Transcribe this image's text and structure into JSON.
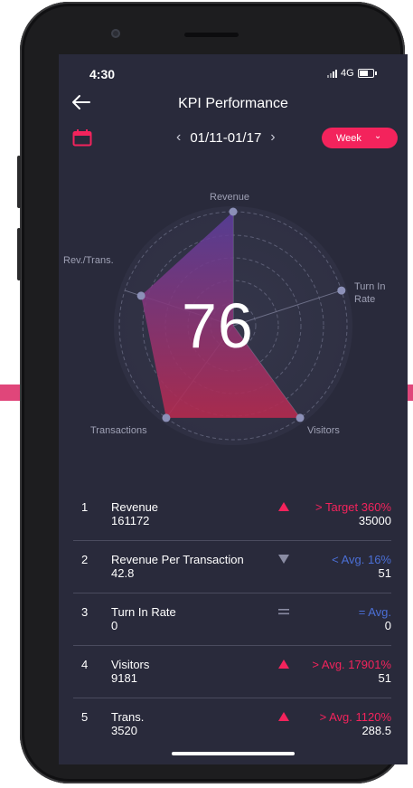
{
  "status": {
    "time": "4:30",
    "network": "4G"
  },
  "header": {
    "title": "KPI Performance"
  },
  "date_nav": {
    "prev_label": "‹",
    "range": "01/11-01/17",
    "next_label": "›"
  },
  "period": {
    "label": "Week",
    "caret": "⌄"
  },
  "radar": {
    "score": "76",
    "axes": [
      "Revenue",
      "Turn In Rate",
      "Visitors",
      "Transactions",
      "Rev./Trans."
    ],
    "label_revenue": "Revenue",
    "label_turn_1": "Turn In",
    "label_turn_2": "Rate",
    "label_visitors": "Visitors",
    "label_transactions": "Transactions",
    "label_revtrans": "Rev./Trans.",
    "values": [
      1.0,
      0.0,
      1.0,
      1.0,
      0.85
    ],
    "colors": {
      "upper": "#5b3fa0",
      "lower": "#b52a4e",
      "point": "#8c90b8"
    }
  },
  "kpis": [
    {
      "num": "1",
      "name": "Revenue",
      "value": "161172",
      "indicator": "up",
      "compare": "> Target  360%",
      "target": "35000",
      "tone": "red"
    },
    {
      "num": "2",
      "name": "Revenue Per Transaction",
      "value": "42.8",
      "indicator": "down",
      "compare": "< Avg. 16%",
      "target": "51",
      "tone": "blue"
    },
    {
      "num": "3",
      "name": "Turn In Rate",
      "value": "0",
      "indicator": "equal",
      "compare": "= Avg.",
      "target": "0",
      "tone": "blue"
    },
    {
      "num": "4",
      "name": "Visitors",
      "value": "9181",
      "indicator": "up",
      "compare": "> Avg. 17901%",
      "target": "51",
      "tone": "red"
    },
    {
      "num": "5",
      "name": "Trans.",
      "value": "3520",
      "indicator": "up",
      "compare": "> Avg. 1120%",
      "target": "288.5",
      "tone": "red"
    }
  ],
  "colors": {
    "accent": "#f3235c",
    "background": "#292a3b",
    "below": "#4b6fd6"
  }
}
